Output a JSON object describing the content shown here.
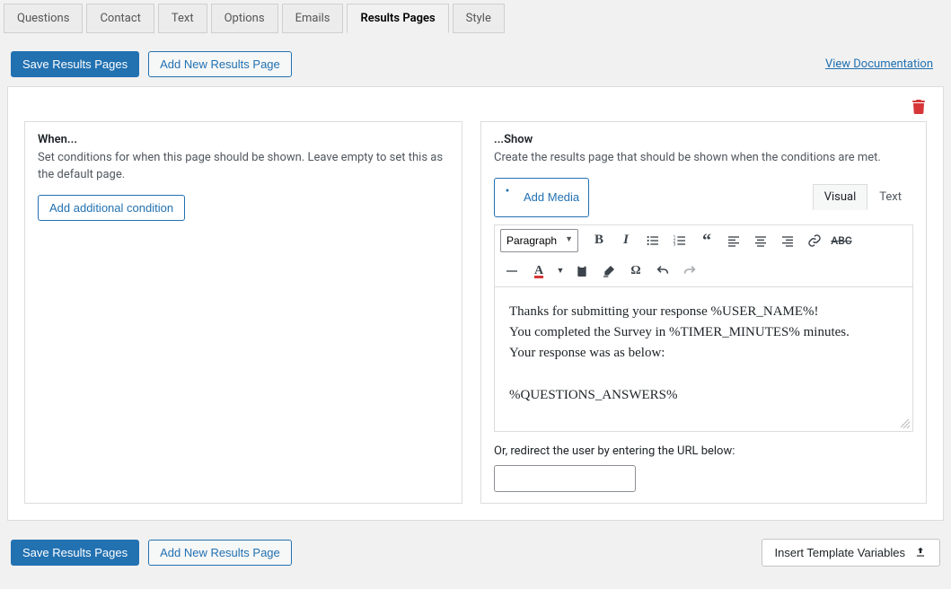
{
  "tabs": [
    "Questions",
    "Contact",
    "Text",
    "Options",
    "Emails",
    "Results Pages",
    "Style"
  ],
  "activeTab": 5,
  "buttons": {
    "save": "Save Results Pages",
    "addNew": "Add New Results Page",
    "viewDoc": "View Documentation",
    "addCondition": "Add additional condition",
    "addMedia": "Add Media",
    "insertTemplate": "Insert Template Variables"
  },
  "when": {
    "heading": "When...",
    "desc": "Set conditions for when this page should be shown. Leave empty to set this as the default page."
  },
  "show": {
    "heading": "...Show",
    "desc": "Create the results page that should be shown when the conditions are met.",
    "editorTabs": {
      "visual": "Visual",
      "text": "Text"
    },
    "formatOption": "Paragraph",
    "content": {
      "line1": "Thanks for submitting your response %USER_NAME%!",
      "line2": "You completed the Survey in %TIMER_MINUTES% minutes.",
      "line3": "Your response was as below:",
      "line4": "%QUESTIONS_ANSWERS%"
    },
    "redirectLabel": "Or, redirect the user by entering the URL below:",
    "urlValue": ""
  }
}
